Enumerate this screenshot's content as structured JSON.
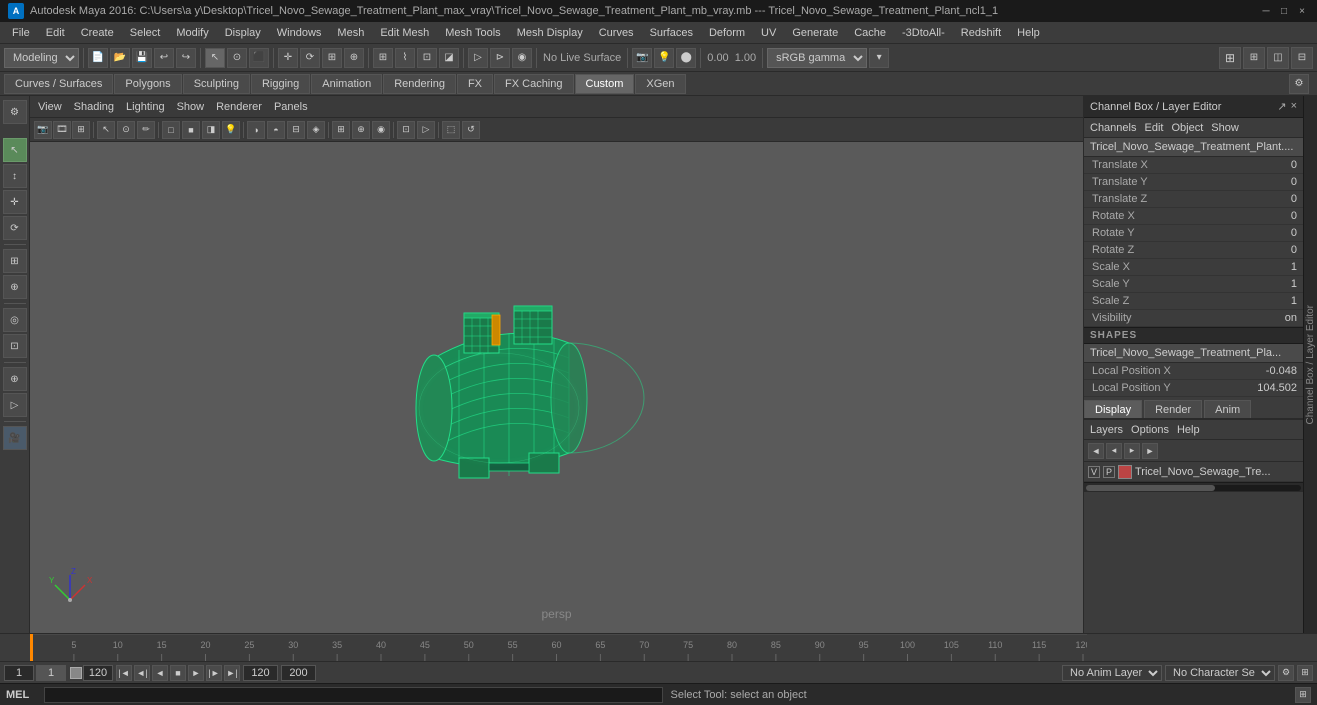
{
  "titlebar": {
    "app": "A",
    "title": "Autodesk Maya 2016: C:\\Users\\a y\\Desktop\\Tricel_Novo_Sewage_Treatment_Plant_max_vray\\Tricel_Novo_Sewage_Treatment_Plant_mb_vray.mb  ---  Tricel_Novo_Sewage_Treatment_Plant_ncl1_1",
    "minimize": "─",
    "maximize": "□",
    "close": "×"
  },
  "menubar": {
    "items": [
      "File",
      "Edit",
      "Create",
      "Select",
      "Modify",
      "Display",
      "Windows",
      "Mesh",
      "Edit Mesh",
      "Mesh Tools",
      "Mesh Display",
      "Curves",
      "Surfaces",
      "Deform",
      "UV",
      "Generate",
      "Cache",
      "-3DtoAll-",
      "Redshift",
      "Help"
    ]
  },
  "toolbar": {
    "workspace_label": "Modeling",
    "live_surface": "No Live Surface",
    "value1": "0.00",
    "value2": "1.00",
    "color_space": "sRGB gamma"
  },
  "tabs": {
    "items": [
      "Curves / Surfaces",
      "Polygons",
      "Sculpting",
      "Rigging",
      "Animation",
      "Rendering",
      "FX",
      "FX Caching",
      "Custom",
      "XGen"
    ]
  },
  "viewport": {
    "menus": [
      "View",
      "Shading",
      "Lighting",
      "Show",
      "Renderer",
      "Panels"
    ],
    "persp_label": "persp"
  },
  "channel_box": {
    "title": "Channel Box / Layer Editor",
    "menus": [
      "Channels",
      "Edit",
      "Object",
      "Show"
    ],
    "object_name": "Tricel_Novo_Sewage_Treatment_Plant....",
    "attributes": [
      {
        "label": "Translate X",
        "value": "0"
      },
      {
        "label": "Translate Y",
        "value": "0"
      },
      {
        "label": "Translate Z",
        "value": "0"
      },
      {
        "label": "Rotate X",
        "value": "0"
      },
      {
        "label": "Rotate Y",
        "value": "0"
      },
      {
        "label": "Rotate Z",
        "value": "0"
      },
      {
        "label": "Scale X",
        "value": "1"
      },
      {
        "label": "Scale Y",
        "value": "1"
      },
      {
        "label": "Scale Z",
        "value": "1"
      },
      {
        "label": "Visibility",
        "value": "on"
      }
    ],
    "shapes_section": "SHAPES",
    "shapes_name": "Tricel_Novo_Sewage_Treatment_Pla...",
    "shape_attrs": [
      {
        "label": "Local Position X",
        "value": "-0.048"
      },
      {
        "label": "Local Position Y",
        "value": "104.502"
      }
    ]
  },
  "display_tabs": {
    "items": [
      "Display",
      "Render",
      "Anim"
    ],
    "active": "Display"
  },
  "layers": {
    "menus": [
      "Layers",
      "Options",
      "Help"
    ],
    "rows": [
      {
        "v": "V",
        "p": "P",
        "color": "#bb4444",
        "name": "Tricel_Novo_Sewage_Tre..."
      }
    ]
  },
  "timeline": {
    "ticks": [
      5,
      10,
      15,
      20,
      25,
      30,
      35,
      40,
      45,
      50,
      55,
      60,
      65,
      70,
      75,
      80,
      85,
      90,
      95,
      100,
      105,
      110,
      115,
      120
    ]
  },
  "anim_controls": {
    "start": "1",
    "current": "1",
    "end": "120",
    "range_start": "1",
    "range_end": "120",
    "max_end": "200",
    "no_anim_layer": "No Anim Layer",
    "no_char_set": "No Character Set"
  },
  "status_bar": {
    "mel_label": "MEL",
    "text": "Select Tool: select an object"
  },
  "left_tools": {
    "buttons": [
      "↖",
      "↕",
      "⟲",
      "⊞",
      "◎",
      "⊡",
      "⊕",
      "⚙"
    ]
  }
}
